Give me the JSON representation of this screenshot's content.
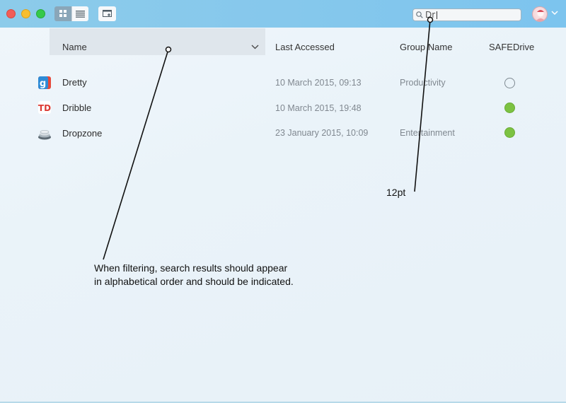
{
  "toolbar": {
    "search_value": "Dr"
  },
  "columns": {
    "name": "Name",
    "last_accessed": "Last Accessed",
    "group_name": "Group Name",
    "safedrive": "SAFEDrive"
  },
  "rows": [
    {
      "name": "Dretty",
      "last_accessed": "10 March 2015, 09:13",
      "group": "Productivity",
      "safedrive": false,
      "icon": "dretty-app-icon"
    },
    {
      "name": "Dribble",
      "last_accessed": "10 March 2015, 19:48",
      "group": "",
      "safedrive": true,
      "icon": "dribble-app-icon"
    },
    {
      "name": "Dropzone",
      "last_accessed": "23 January 2015, 10:09",
      "group": "Entertainment",
      "safedrive": true,
      "icon": "dropzone-app-icon"
    }
  ],
  "annotations": {
    "search_size_note": "12pt",
    "filter_note_line1": "When filtering, search results should appear",
    "filter_note_line2": "in alphabetical order and should be indicated."
  },
  "colors": {
    "titlebar": "#86c8ec",
    "status_on": "#7cc242",
    "header_selected": "#dfe6ec"
  }
}
